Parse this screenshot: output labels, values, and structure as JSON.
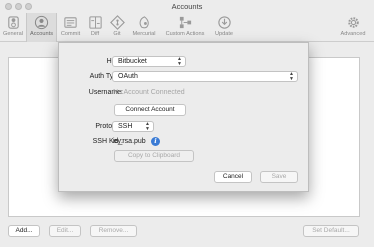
{
  "window": {
    "title": "Accounts"
  },
  "toolbar": {
    "items": [
      {
        "label": "General",
        "icon": "switch-icon"
      },
      {
        "label": "Accounts",
        "icon": "account-icon"
      },
      {
        "label": "Commit",
        "icon": "commit-icon"
      },
      {
        "label": "Diff",
        "icon": "diff-icon"
      },
      {
        "label": "Git",
        "icon": "git-icon"
      },
      {
        "label": "Mercurial",
        "icon": "mercurial-icon"
      },
      {
        "label": "Custom Actions",
        "icon": "custom-actions-icon"
      },
      {
        "label": "Update",
        "icon": "update-icon"
      },
      {
        "label": "Advanced",
        "icon": "gear-icon"
      }
    ]
  },
  "dialog": {
    "host_label": "Host:",
    "host_value": "Bitbucket",
    "auth_label": "Auth Type:",
    "auth_value": "OAuth",
    "username_label": "Username:",
    "username_value": "No Account Connected",
    "connect_button": "Connect Account",
    "protocol_label": "Protocol:",
    "protocol_value": "SSH",
    "sshkey_label": "SSH Key:",
    "sshkey_value": "id_rsa.pub",
    "copy_button": "Copy to Clipboard",
    "cancel_button": "Cancel",
    "save_button": "Save"
  },
  "bottom": {
    "add": "Add...",
    "edit": "Edit...",
    "remove": "Remove...",
    "set_default": "Set Default..."
  },
  "colors": {
    "info_blue": "#3a7bd5"
  }
}
